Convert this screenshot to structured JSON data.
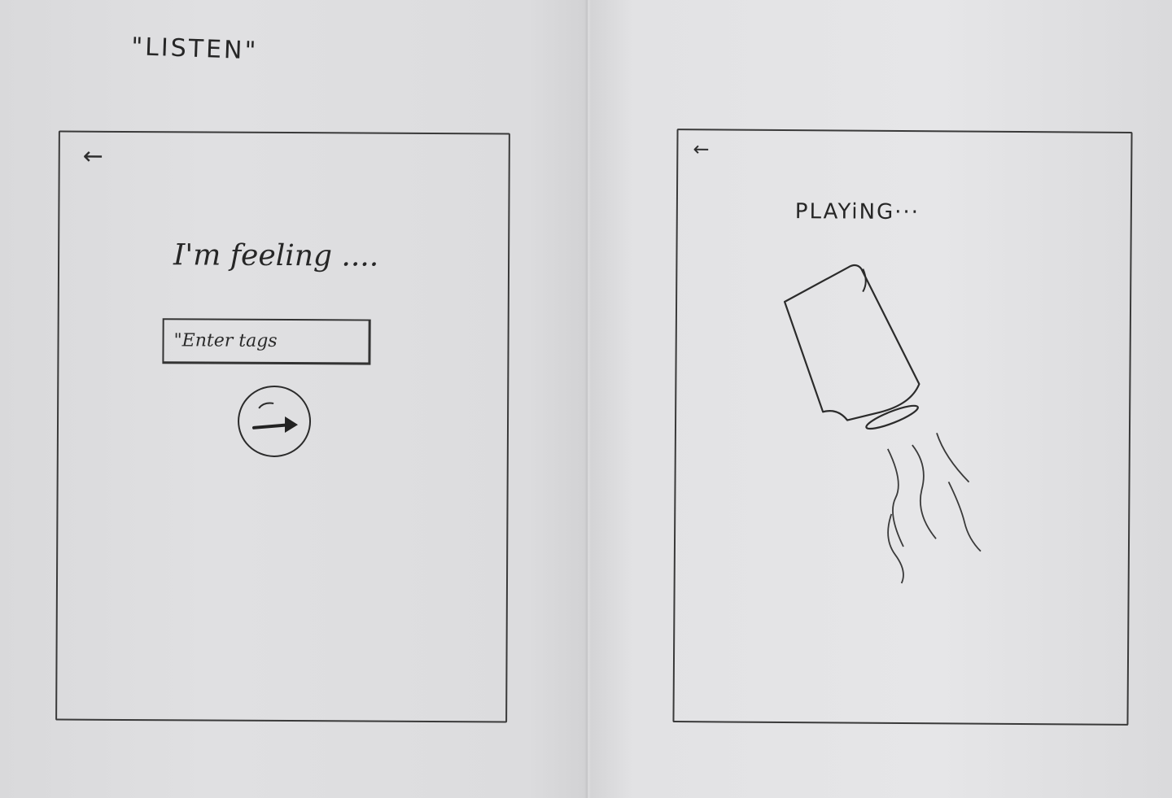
{
  "page": {
    "title": "\"LISTEN\""
  },
  "screen_input": {
    "back_icon": "←",
    "heading": "I'm feeling ....",
    "tags_input": {
      "placeholder": "\"Enter tags",
      "value": ""
    },
    "go_button_icon": "arrow-right-icon"
  },
  "screen_playing": {
    "back_icon": "←",
    "status": "PLAYiNG···",
    "illustration": "pouring-can-icon"
  },
  "colors": {
    "paper": "#e0e0e2",
    "ink": "#2b2b2b"
  }
}
